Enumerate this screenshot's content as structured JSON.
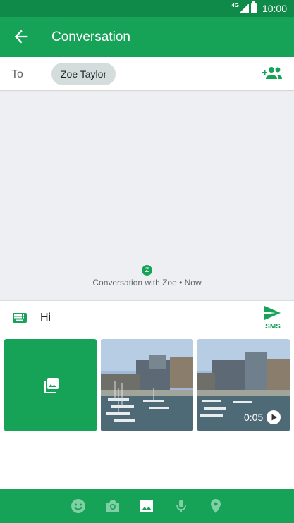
{
  "status_bar": {
    "network": "4G",
    "time": "10:00"
  },
  "app_bar": {
    "title": "Conversation"
  },
  "recipients": {
    "to_label": "To",
    "contact_chip": "Zoe Taylor"
  },
  "conversation": {
    "avatar_letter": "Z",
    "info_text": "Conversation with Zoe • Now"
  },
  "compose": {
    "message_text": "Hi",
    "send_label": "SMS"
  },
  "media": {
    "video_duration": "0:05"
  },
  "icons": {
    "back": "arrow-back-icon",
    "add_people": "person-add-icon",
    "keyboard": "keyboard-icon",
    "send": "send-icon",
    "gallery": "photo-library-icon",
    "play": "play-icon",
    "bottom": [
      "emoji-icon",
      "camera-icon",
      "image-icon",
      "mic-icon",
      "location-icon"
    ]
  },
  "colors": {
    "status_bar": "#0f8a48",
    "primary": "#16a257",
    "chip": "#d5dcdc",
    "conversation_bg": "#edeff3"
  }
}
